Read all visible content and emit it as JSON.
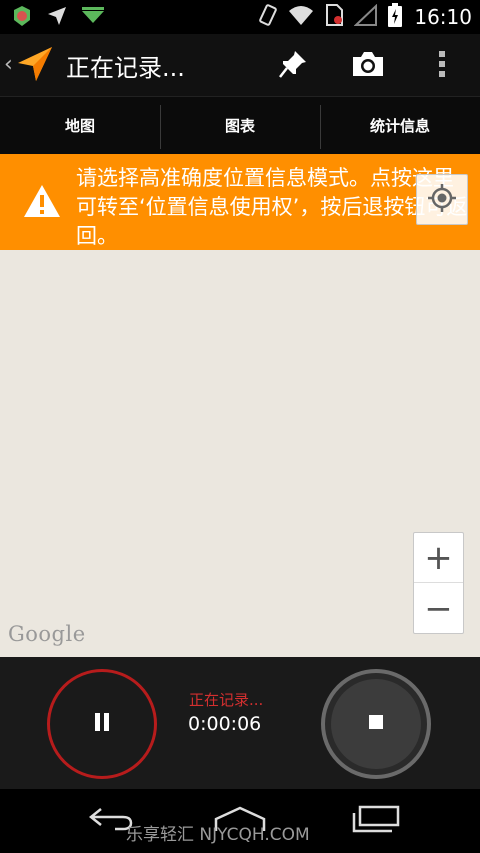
{
  "status_bar": {
    "time": "16:10",
    "left_icons": [
      "app-badge-icon",
      "navigation-arrow-icon",
      "download-notification-icon"
    ],
    "right_icons": [
      "vibrate-icon",
      "wifi-icon",
      "sim-card-icon",
      "cell-signal-icon",
      "battery-charging-icon"
    ]
  },
  "action_bar": {
    "title": "正在记录...",
    "back_icon": "chevron-left-icon",
    "app_icon": "navigation-arrow-icon",
    "actions": [
      "pin-icon",
      "camera-icon",
      "overflow-menu-icon"
    ]
  },
  "tabs": [
    {
      "label": "地图"
    },
    {
      "label": "图表"
    },
    {
      "label": "统计信息"
    }
  ],
  "banner": {
    "text": "请选择高准确度位置信息模式。点按这里可转至‘位置信息使用权’，按后退按钮可返回。",
    "icon": "warning-icon",
    "color": "#ff8f00"
  },
  "map": {
    "background": "#ebe7df",
    "zoom_in": "+",
    "zoom_out": "−",
    "attribution": "Google",
    "locate_icon": "my-location-icon"
  },
  "controls": {
    "status_label": "正在记录...",
    "elapsed_time": "0:00:06",
    "pause_icon": "pause-icon",
    "stop_icon": "stop-icon",
    "accent": "#d32f2f"
  },
  "nav_bar": {
    "watermark": "乐享轻汇 NJYCQH.COM",
    "buttons": [
      "back-icon",
      "home-icon",
      "recent-apps-icon"
    ]
  }
}
